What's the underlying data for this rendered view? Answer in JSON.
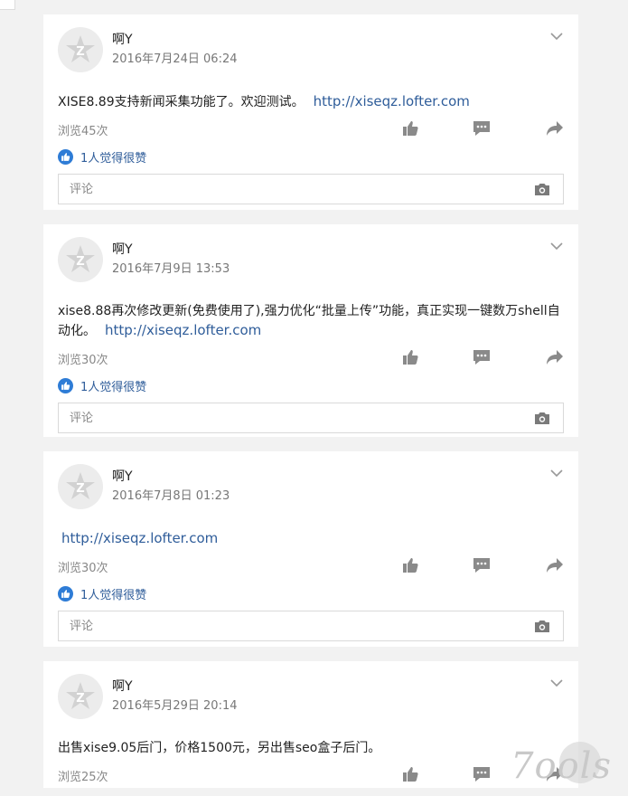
{
  "posts": [
    {
      "username": "啊Y",
      "date": "2016年7月24日 06:24",
      "text": "XISE8.89支持新闻采集功能了。欢迎测试。",
      "link": "http://xiseqz.lofter.com",
      "views": "浏览45次",
      "likes": "1人觉得很赞",
      "comment_placeholder": "评论"
    },
    {
      "username": "啊Y",
      "date": "2016年7月9日 13:53",
      "text": "xise8.88再次修改更新(免费使用了),强力优化“批量上传”功能，真正实现一键数万shell自动化。",
      "link": "http://xiseqz.lofter.com",
      "views": "浏览30次",
      "likes": "1人觉得很赞",
      "comment_placeholder": "评论"
    },
    {
      "username": "啊Y",
      "date": "2016年7月8日 01:23",
      "text": "",
      "link": "http://xiseqz.lofter.com",
      "views": "浏览30次",
      "likes": "1人觉得很赞",
      "comment_placeholder": "评论"
    },
    {
      "username": "啊Y",
      "date": "2016年5月29日 20:14",
      "text": "出售xise9.05后门，价格1500元，另出售seo盒子后门。",
      "views": "浏览25次"
    }
  ],
  "watermark": "7ools",
  "icons": {
    "avatar": "default-avatar-icon",
    "menu": "chevron-down-icon",
    "like": "thumbs-up-icon",
    "comment": "comment-icon",
    "share": "share-icon",
    "liked": "blue-like-icon",
    "camera": "camera-icon"
  },
  "colors": {
    "link": "#2f5d9a",
    "like_badge": "#2e7cd6",
    "icon_gray": "#8a8a8a"
  }
}
